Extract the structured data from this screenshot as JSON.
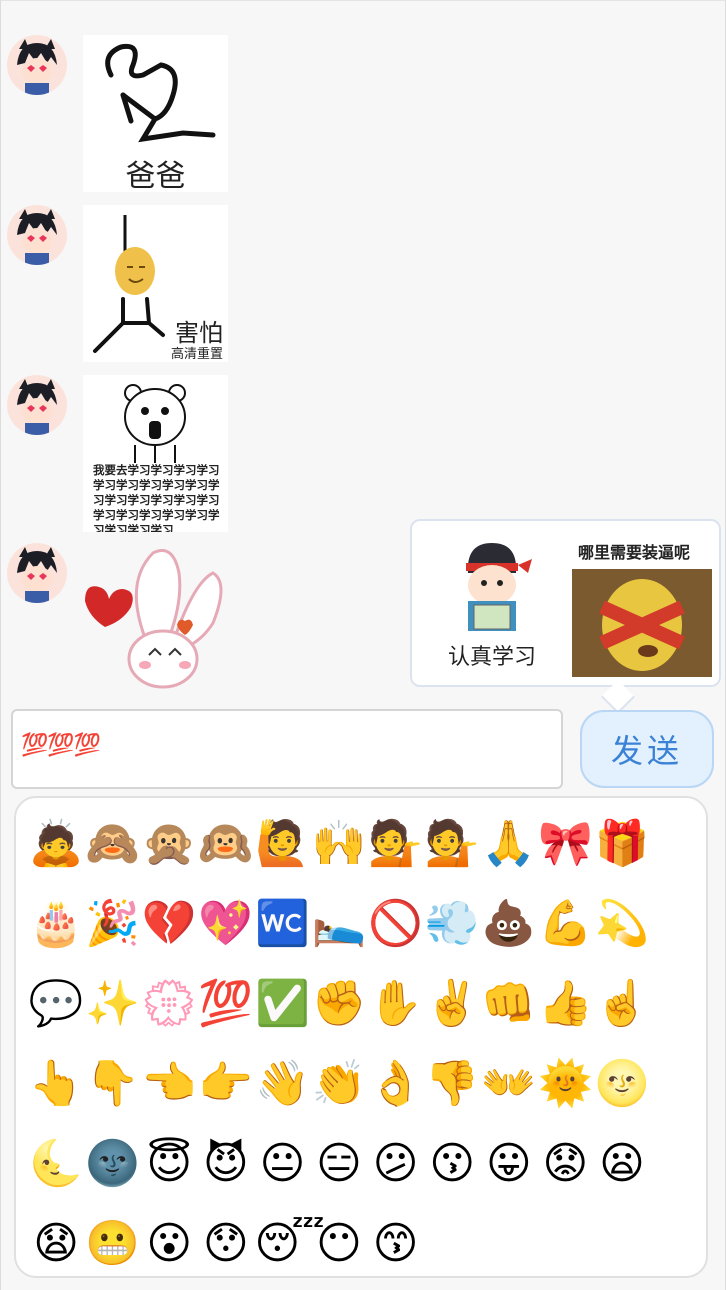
{
  "messages": [
    {
      "sticker_caption": "爸爸",
      "sticker_sub": ""
    },
    {
      "sticker_caption": "害怕",
      "sticker_sub": "高清重置"
    },
    {
      "sticker_caption": "我要去学习学习学习学习学习学习学习学习学习学习学习学习学习学习学习学习学习学习学习学习学习学习学习学习",
      "sticker_sub": ""
    },
    {
      "sticker_caption": "",
      "sticker_sub": ""
    }
  ],
  "suggestions": [
    {
      "caption": "认真学习"
    },
    {
      "caption": "哪里需要装逼呢"
    }
  ],
  "input": {
    "value": "💯💯💯"
  },
  "send_button": {
    "label": "发送"
  },
  "emoji_panel": {
    "emojis": [
      "🙇",
      "🙈",
      "🙊",
      "🙉",
      "🙋",
      "🙌",
      "💁",
      "💁",
      "🙏",
      "🎀",
      "🎁",
      "🎂",
      "🎉",
      "💔",
      "💖",
      "🚾",
      "🛌",
      "🚫",
      "💨",
      "💩",
      "💪",
      "💫",
      "💬",
      "✨",
      "💮",
      "💯",
      "✅",
      "✊",
      "✋",
      "✌️",
      "👊",
      "👍",
      "☝️",
      "👆",
      "👇",
      "👈",
      "👉",
      "👋",
      "👏",
      "👌",
      "👎",
      "👐",
      "🌞",
      "🌝",
      "🌜",
      "🌚",
      "😇",
      "😈",
      "😐",
      "😑",
      "😕",
      "😗",
      "😛",
      "😟",
      "😦",
      "😧",
      "😬",
      "😮",
      "😯",
      "😴",
      "😶",
      "😙"
    ]
  },
  "colors": {
    "send_text": "#3b82d6",
    "send_bg": "#e3f0fd",
    "input_text": "#d21c2c"
  }
}
